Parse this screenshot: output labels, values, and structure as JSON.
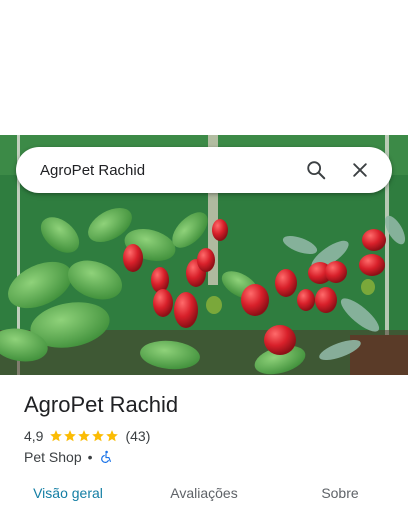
{
  "search": {
    "query": "AgroPet Rachid",
    "search_icon": "search-icon",
    "close_icon": "close-icon"
  },
  "place": {
    "name": "AgroPet Rachid",
    "rating": "4,9",
    "stars": 5,
    "reviews": "(43)",
    "category": "Pet Shop",
    "separator": "•",
    "accessibility_icon": "wheelchair-icon"
  },
  "tabs": [
    {
      "label": "Visão geral",
      "active": true
    },
    {
      "label": "Avaliações",
      "active": false
    },
    {
      "label": "Sobre",
      "active": false
    }
  ],
  "colors": {
    "star": "#fbbc04",
    "active_tab": "#137ea4",
    "accessibility": "#1a73e8"
  }
}
